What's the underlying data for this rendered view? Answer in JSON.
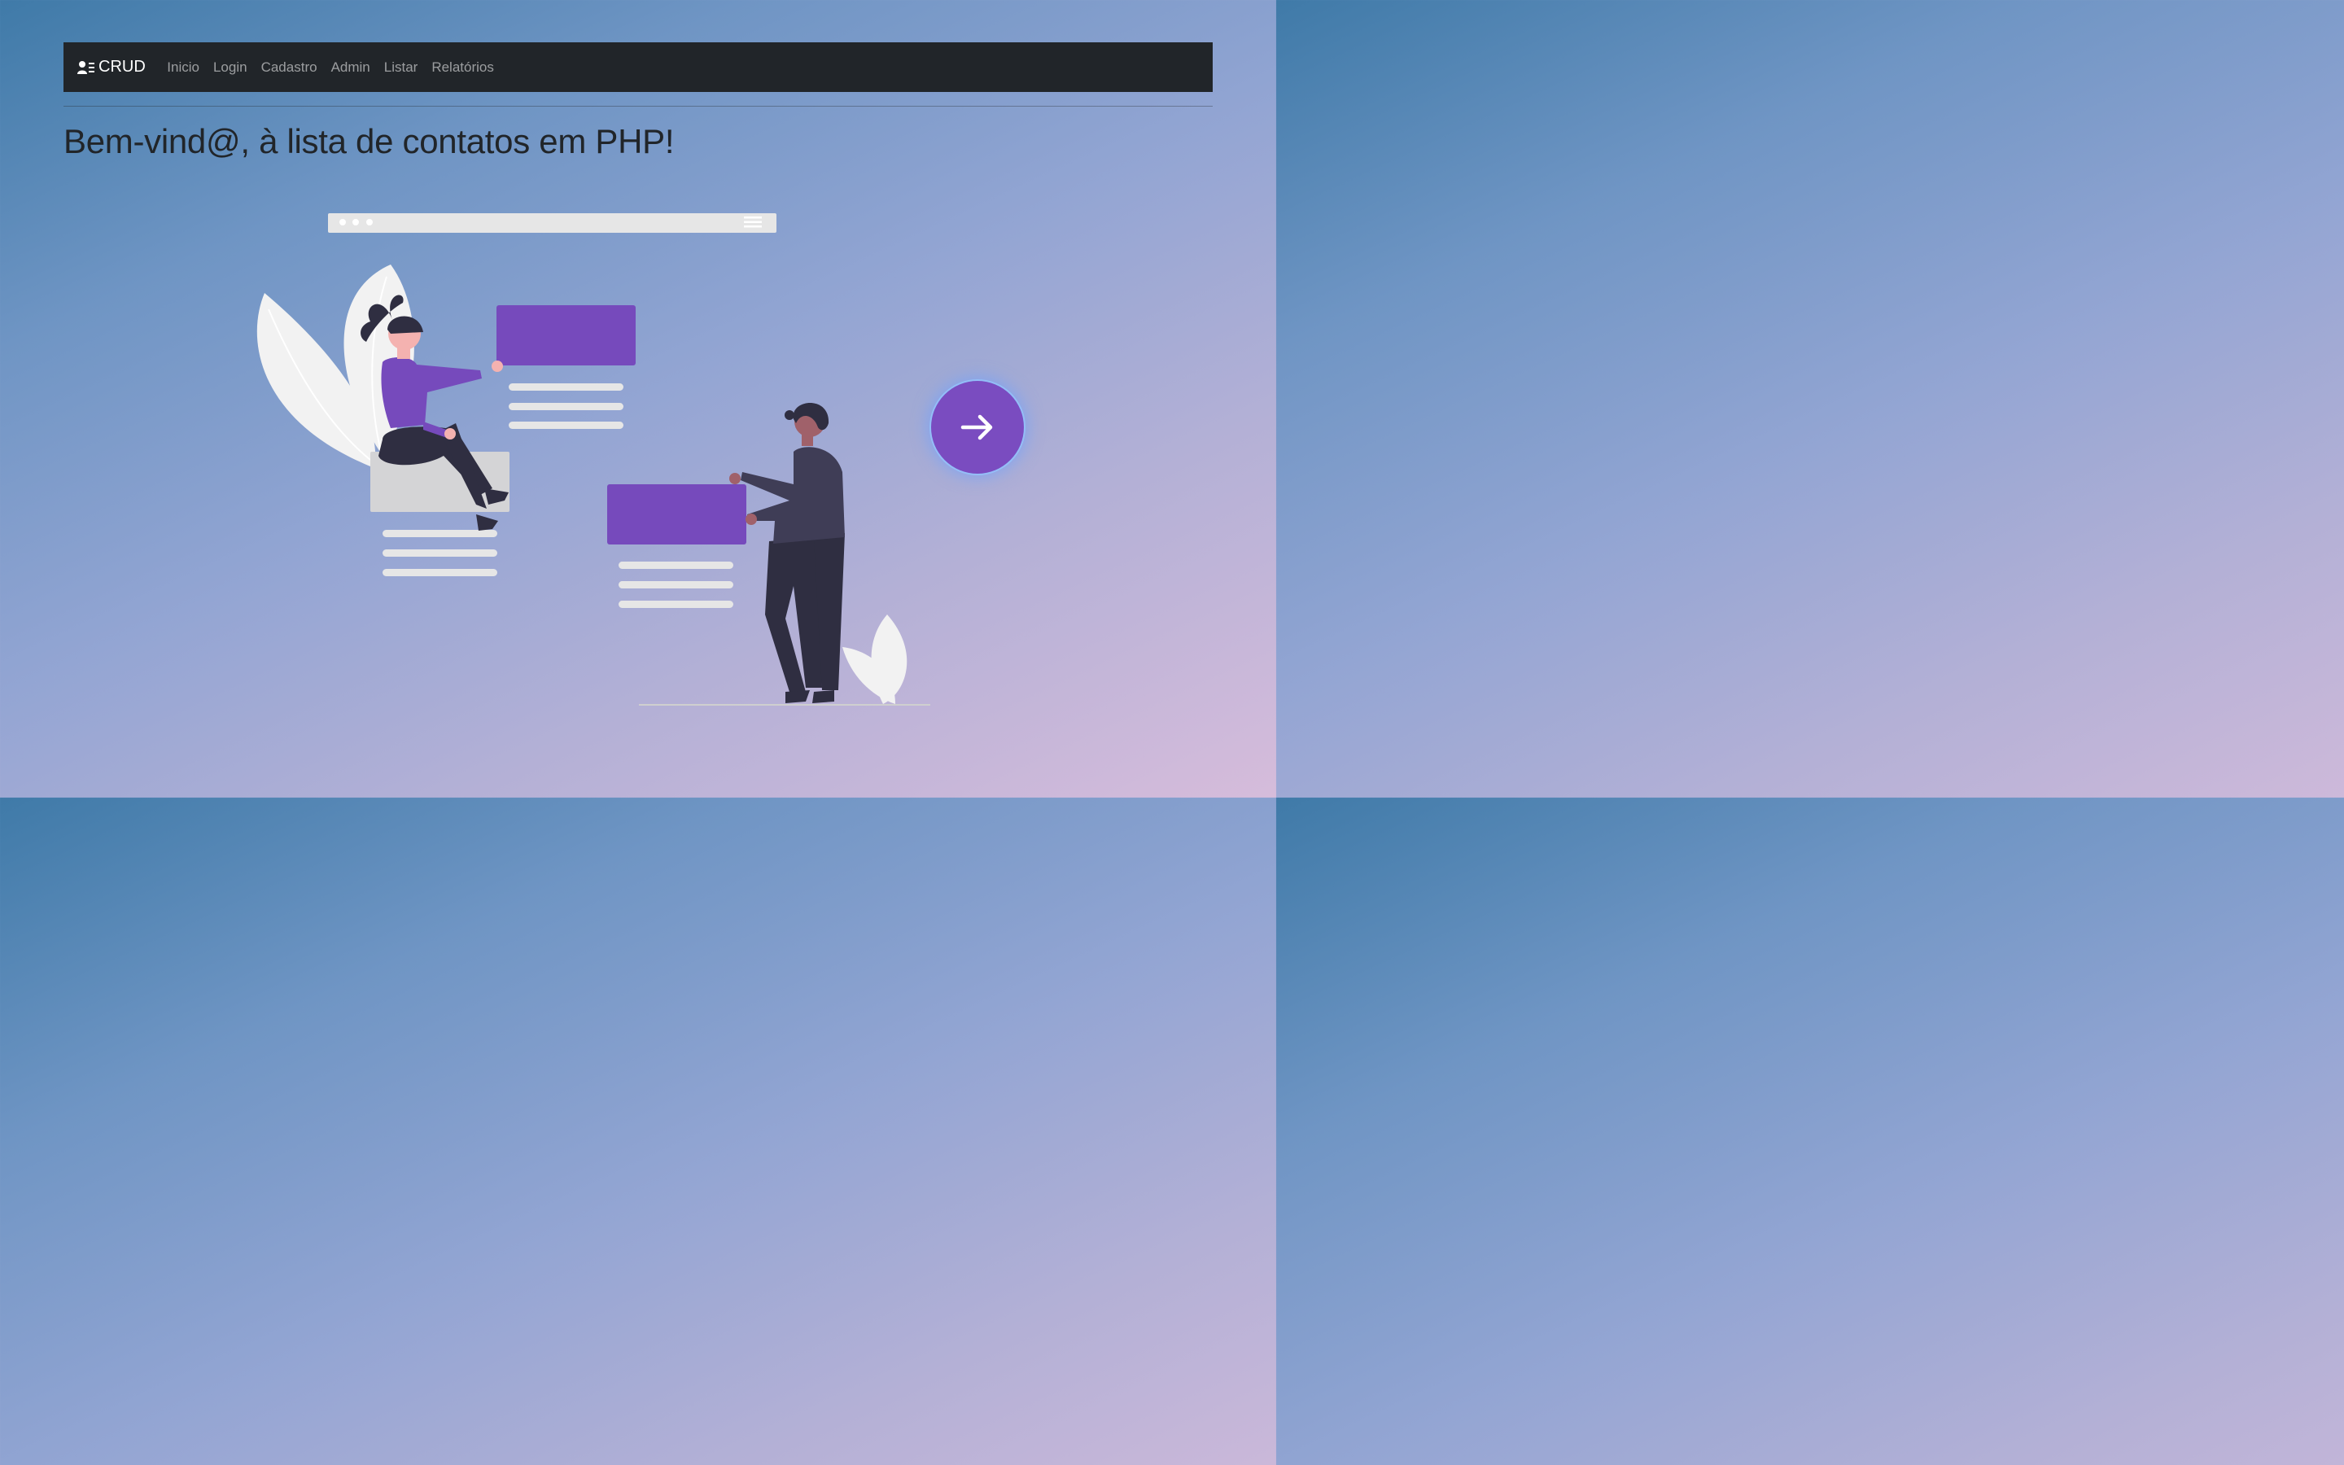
{
  "navbar": {
    "brand_label": "CRUD",
    "brand_icon": "user-list-icon",
    "links": [
      "Inicio",
      "Login",
      "Cadastro",
      "Admin",
      "Listar",
      "Relatórios"
    ]
  },
  "main": {
    "title": "Bem-vind@, à lista de contatos em PHP!"
  },
  "action": {
    "icon": "arrow-right-icon"
  },
  "colors": {
    "navbar_bg": "#212529",
    "accent_purple": "#764abc",
    "button_glow": "#6ea0ff"
  }
}
